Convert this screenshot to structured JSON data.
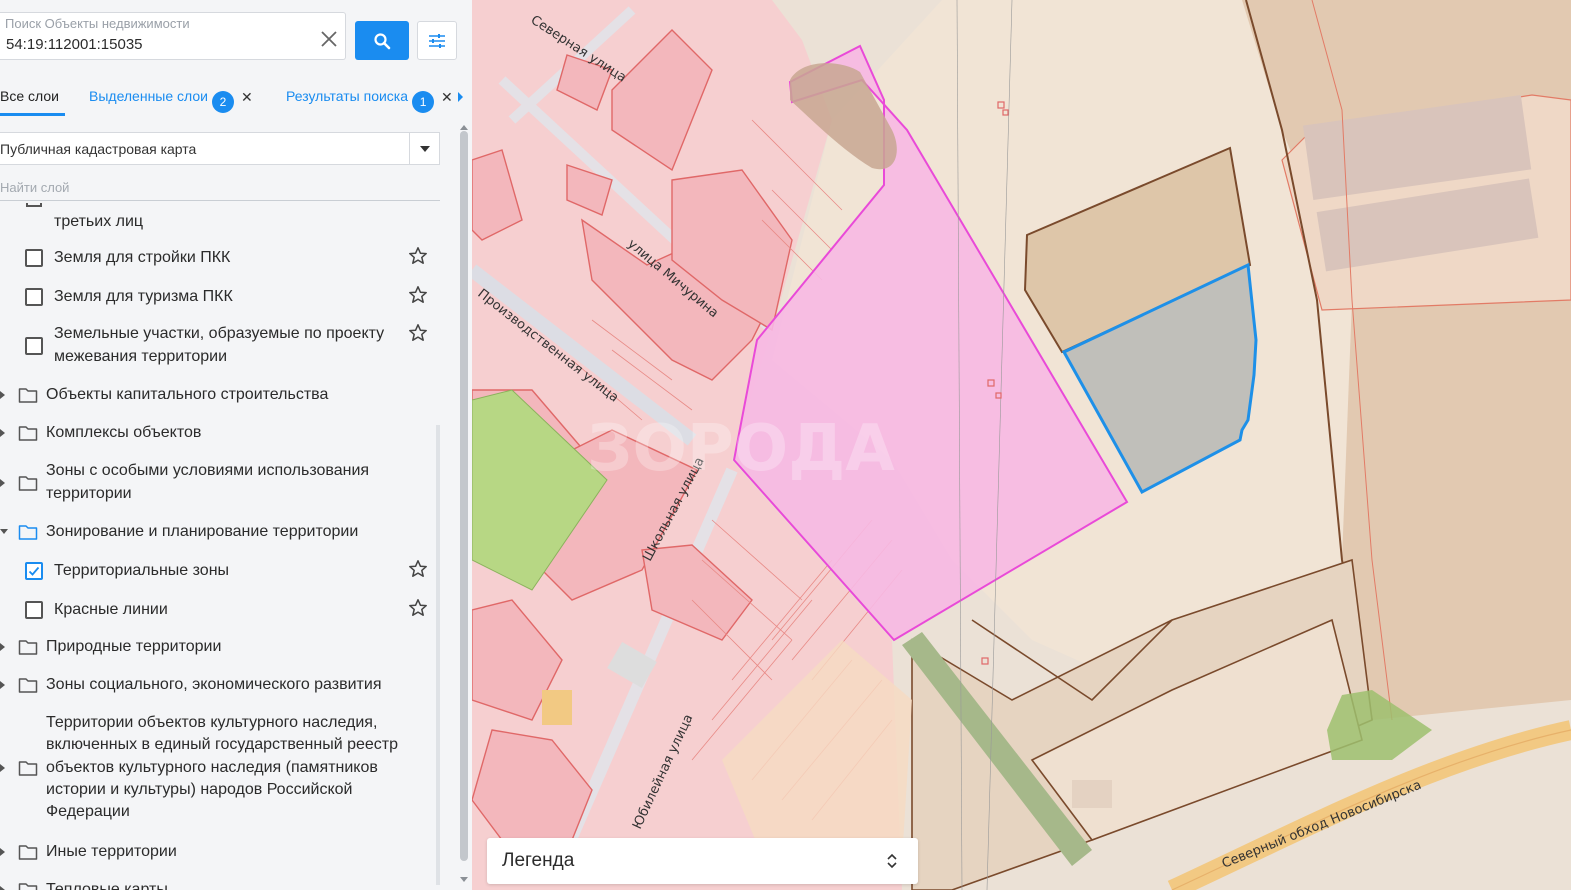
{
  "search": {
    "label": "Поиск Объекты недвижимости",
    "value": "54:19:112001:15035"
  },
  "tabs": {
    "all": "Все слои",
    "selected": "Выделенные слои",
    "selected_count": "2",
    "results": "Результаты поиска",
    "results_count": "1"
  },
  "map_select": {
    "value": "Публичная кадастровая карта"
  },
  "layer_search": {
    "placeholder": "Найти слой"
  },
  "tree": {
    "partial": "третьих лиц",
    "items": [
      {
        "label": "Земля для стройки ПКК"
      },
      {
        "label": "Земля для туризма ПКК"
      },
      {
        "label_line1": "Земельные участки, образуемые по проекту",
        "label_line2": "межевания территории"
      }
    ],
    "folders": [
      "Объекты капитального строительства",
      "Комплексы объектов"
    ],
    "zones_special": {
      "line1": "Зоны с особыми условиями использования",
      "line2": "территории"
    },
    "zoning": "Зонирование и планирование территории",
    "zoning_children": [
      {
        "label": "Территориальные зоны",
        "checked": true
      },
      {
        "label": "Красные линии",
        "checked": false
      }
    ],
    "natural": "Природные территории",
    "social": "Зоны социального, экономического развития",
    "heritage": {
      "line1": "Территории объектов культурного наследия,",
      "line2": "включенных в единый государственный реестр",
      "line3": "объектов культурного наследия (памятников",
      "line4": "истории и культуры) народов Российской",
      "line5": "Федерации"
    },
    "other": "Иные территории",
    "heat": "Тепловые карты"
  },
  "map": {
    "streets": {
      "severnaya": "Северная улица",
      "michurina": "улица Мичурина",
      "proizv": "Производственная улица",
      "shkolnaya": "Школьная улица",
      "yubil": "Юбилейная улица",
      "obhod": "Северный обход Новосибирска"
    },
    "watermark": "ЗОРОДА"
  },
  "legend": {
    "title": "Легенда"
  },
  "colors": {
    "accent": "#1a8cf0",
    "highlight_parcel": "#e94ad8",
    "selected_parcel": "#1e90e8"
  }
}
